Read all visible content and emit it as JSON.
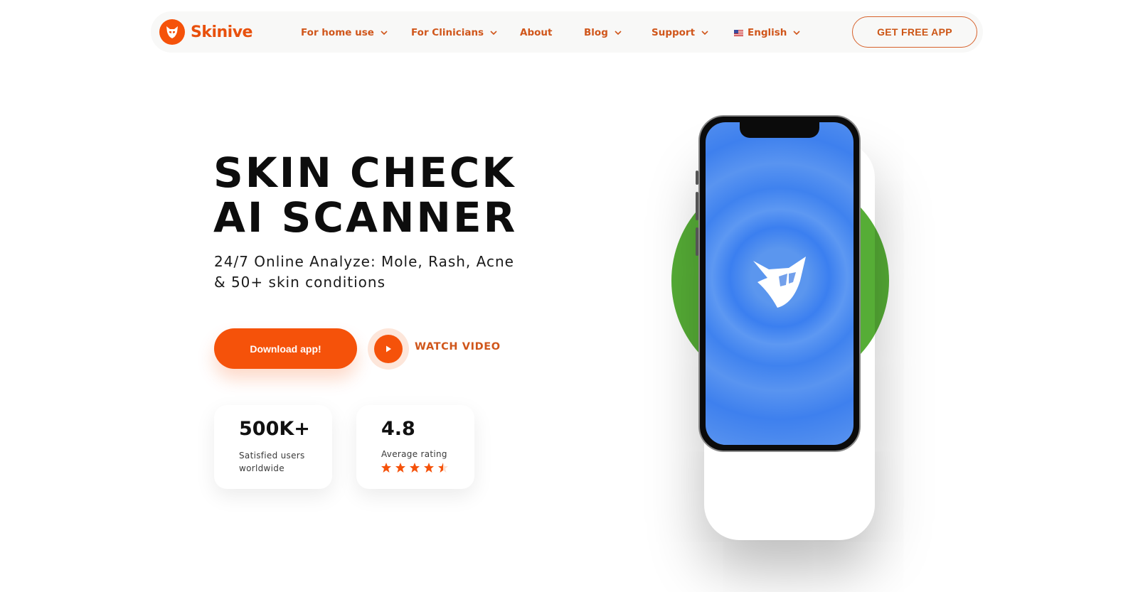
{
  "brand": {
    "name": "Skinive"
  },
  "nav": {
    "items": [
      {
        "label": "For home use",
        "has_dropdown": true
      },
      {
        "label": "For Clinicians",
        "has_dropdown": true
      },
      {
        "label": "About",
        "has_dropdown": false
      },
      {
        "label": "Blog",
        "has_dropdown": true
      },
      {
        "label": "Support",
        "has_dropdown": true
      }
    ],
    "language": {
      "label": "English",
      "icon": "us-flag-icon"
    },
    "cta_label": "GET FREE APP"
  },
  "hero": {
    "headline_line1": "SKIN CHECK",
    "headline_line2": "AI SCANNER",
    "sub_line1": "24/7 Online Analyze: Mole, Rash, Acne",
    "sub_line2": "& 50+ skin conditions",
    "download_label": "Download app!",
    "watch_video_label": "WATCH VIDEO"
  },
  "stats": [
    {
      "value": "500K+",
      "label_line1": "Satisfied users",
      "label_line2": "worldwide"
    },
    {
      "value": "4.8",
      "label_line1": "Average rating",
      "rating": 4.5,
      "stars_max": 5
    }
  ],
  "colors": {
    "accent": "#f5520a",
    "nav_text": "#d0561b",
    "phone_screen": "#3b7ff0",
    "circle": "#56ad36"
  }
}
